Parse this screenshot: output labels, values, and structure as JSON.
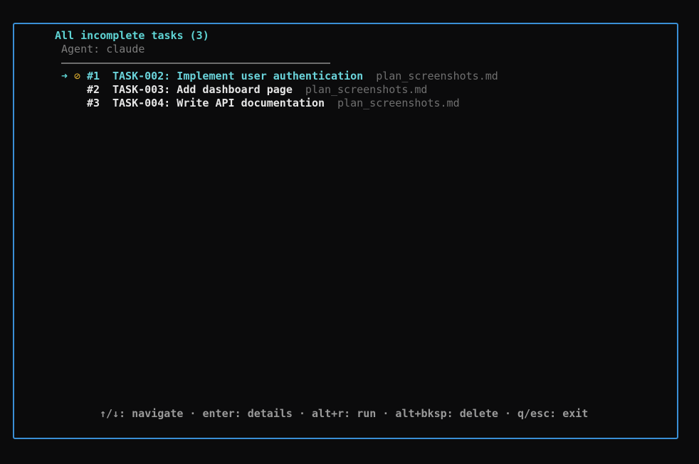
{
  "header": {
    "title": "All incomplete tasks (3)",
    "agent": "Agent: claude"
  },
  "tasks": [
    {
      "cursor": "➜",
      "status": "⊘",
      "number": "#1",
      "label": "TASK-002: Implement user authentication",
      "file": "plan_screenshots.md",
      "selected": true
    },
    {
      "cursor": "",
      "status": "",
      "number": "#2",
      "label": "TASK-003: Add dashboard page",
      "file": "plan_screenshots.md",
      "selected": false
    },
    {
      "cursor": "",
      "status": "",
      "number": "#3",
      "label": "TASK-004: Write API documentation",
      "file": "plan_screenshots.md",
      "selected": false
    }
  ],
  "footer": {
    "help": "↑/↓: navigate · enter: details · alt+r: run · alt+bksp: delete · q/esc: exit"
  },
  "colors": {
    "border": "#3a8fd6",
    "accent": "#5fd4d4",
    "status_blocked": "#e0b030",
    "muted": "#6f6f6f"
  }
}
